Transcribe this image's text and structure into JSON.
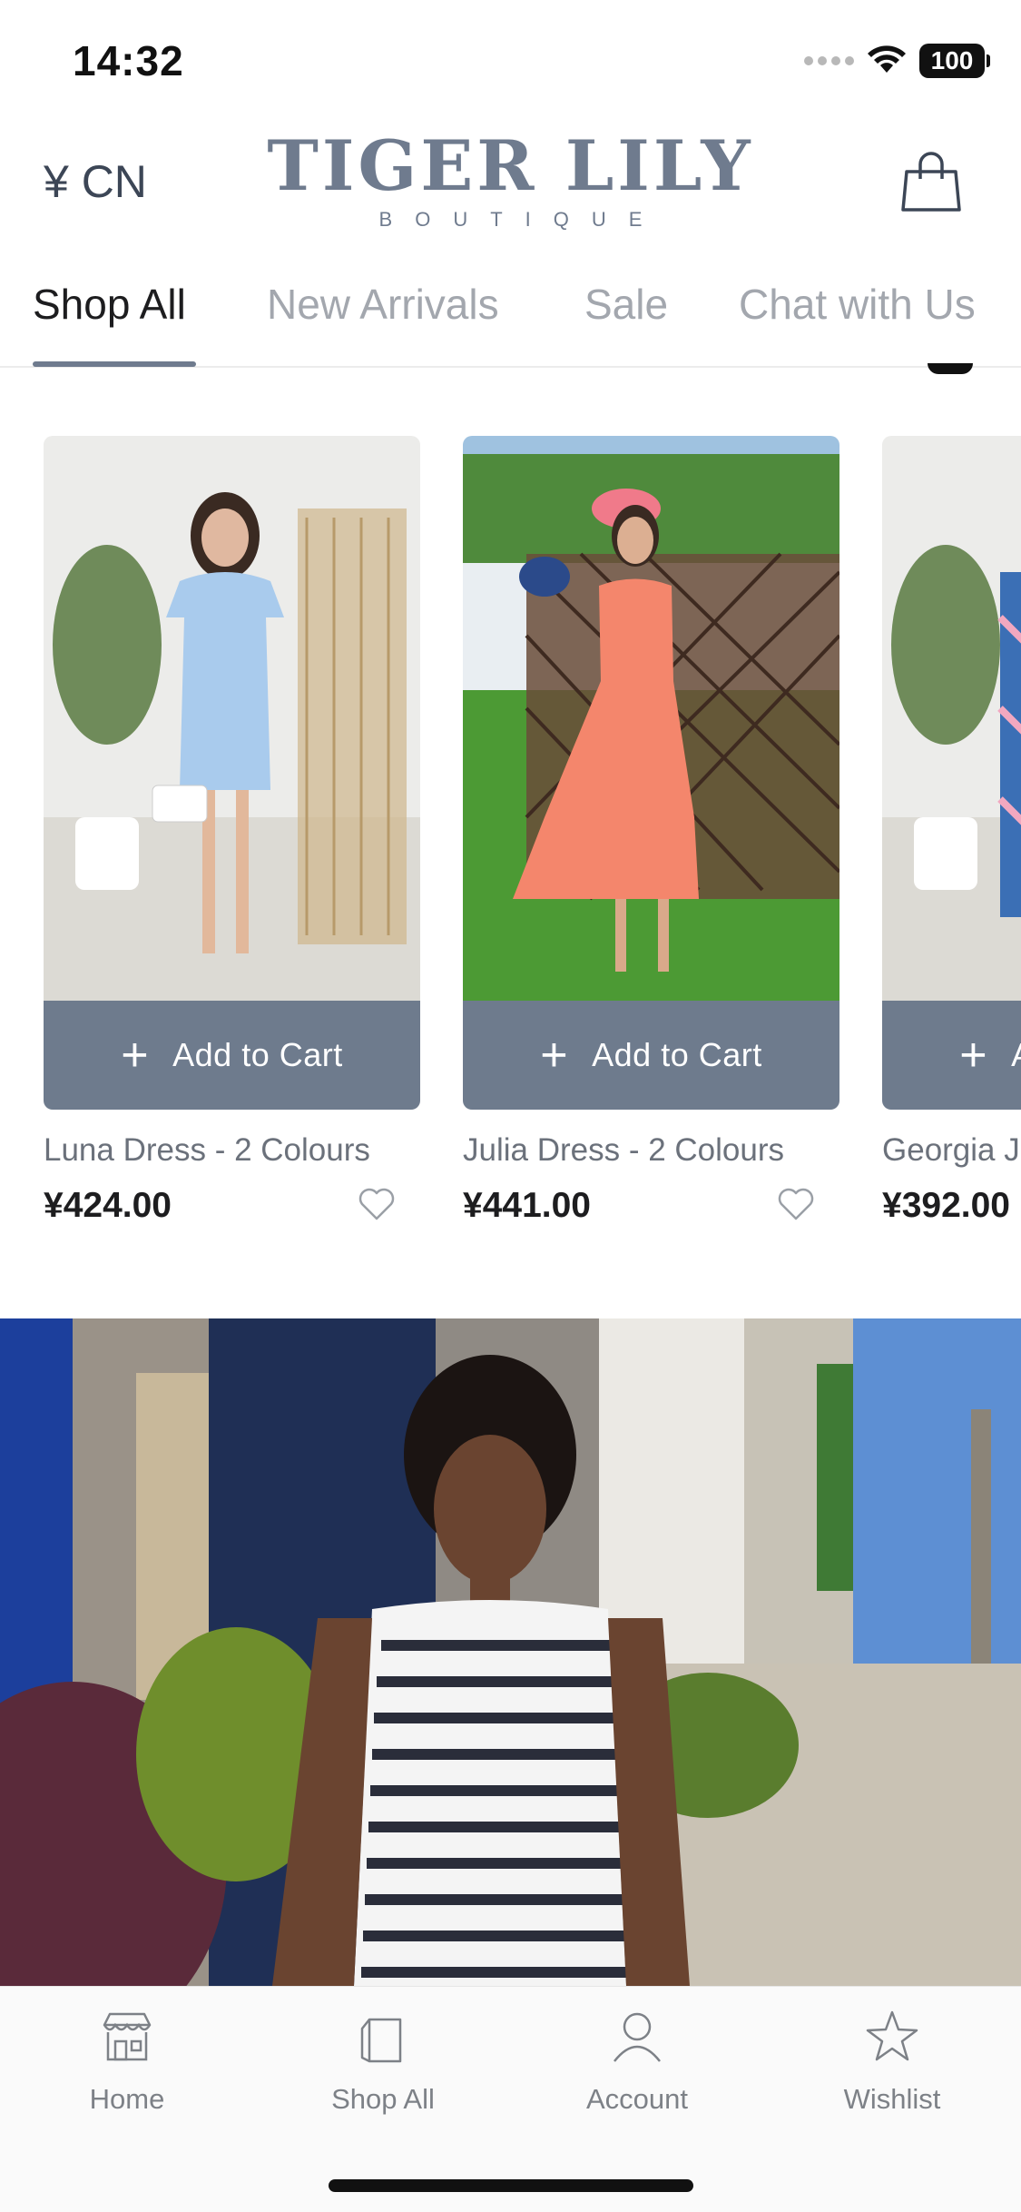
{
  "status_bar": {
    "time": "14:32",
    "battery": "100"
  },
  "header": {
    "currency": "¥ CN",
    "brand_main": "TIGER LILY",
    "brand_sub": "BOUTIQUE"
  },
  "tabs": [
    {
      "label": "Shop All",
      "active": true
    },
    {
      "label": "New Arrivals",
      "active": false
    },
    {
      "label": "Sale",
      "active": false
    },
    {
      "label": "Chat with Us",
      "active": false
    }
  ],
  "products": [
    {
      "name": "Luna Dress - 2 Colours",
      "price": "¥424.00",
      "button": "Add to Cart"
    },
    {
      "name": "Julia Dress - 2 Colours",
      "price": "¥441.00",
      "button": "Add to Cart"
    },
    {
      "name": "Georgia J Floral",
      "price": "¥392.00",
      "button": "Add to Cart"
    }
  ],
  "bottom_nav": [
    {
      "label": "Home",
      "icon": "storefront-icon"
    },
    {
      "label": "Shop All",
      "icon": "shopping-bag-icon"
    },
    {
      "label": "Account",
      "icon": "person-icon"
    },
    {
      "label": "Wishlist",
      "icon": "star-icon"
    }
  ],
  "colors": {
    "accent": "#6e7b8d",
    "brand": "#6f7b8e"
  }
}
